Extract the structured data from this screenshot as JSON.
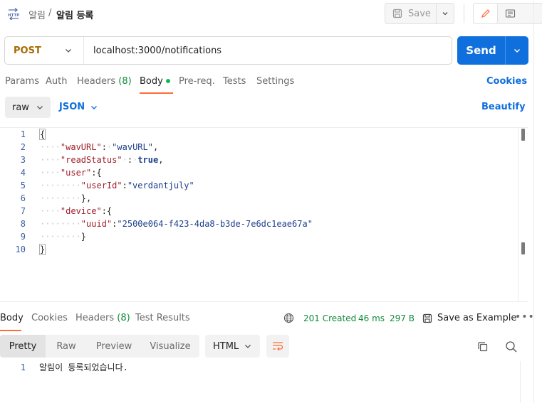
{
  "breadcrumb": {
    "parent": "알림",
    "separator": "/",
    "current": "알림 등록"
  },
  "toolbar": {
    "save_label": "Save"
  },
  "request": {
    "method": "POST",
    "url": "localhost:3000/notifications",
    "send_label": "Send"
  },
  "request_tabs": [
    {
      "label": "Params"
    },
    {
      "label": "Auth"
    },
    {
      "label": "Headers",
      "count": "(8)"
    },
    {
      "label": "Body"
    },
    {
      "label": "Pre-req."
    },
    {
      "label": "Tests"
    },
    {
      "label": "Settings"
    }
  ],
  "cookies_label": "Cookies",
  "body_options": {
    "mode": "raw",
    "language": "JSON",
    "beautify_label": "Beautify"
  },
  "editor": {
    "line_numbers": [
      "1",
      "2",
      "3",
      "4",
      "5",
      "6",
      "7",
      "8",
      "9",
      "10"
    ],
    "lines": [
      {
        "dots": "",
        "tokens": [
          {
            "t": "punc",
            "v": "{"
          }
        ]
      },
      {
        "dots": "····",
        "tokens": [
          {
            "t": "key",
            "v": "\"wavURL\""
          },
          {
            "t": "punc",
            "v": ":"
          },
          {
            "t": "dot",
            "v": "·"
          },
          {
            "t": "str",
            "v": "\"wavURL\""
          },
          {
            "t": "punc",
            "v": ","
          }
        ]
      },
      {
        "dots": "····",
        "tokens": [
          {
            "t": "key",
            "v": "\"readStatus\""
          },
          {
            "t": "dot",
            "v": "·"
          },
          {
            "t": "punc",
            "v": ":"
          },
          {
            "t": "dot",
            "v": "·"
          },
          {
            "t": "kw",
            "v": "true"
          },
          {
            "t": "punc",
            "v": ","
          }
        ]
      },
      {
        "dots": "····",
        "tokens": [
          {
            "t": "key",
            "v": "\"user\""
          },
          {
            "t": "punc",
            "v": ":{"
          }
        ]
      },
      {
        "dots": "········",
        "tokens": [
          {
            "t": "key",
            "v": "\"userId\""
          },
          {
            "t": "punc",
            "v": ":"
          },
          {
            "t": "str",
            "v": "\"verdantjuly\""
          }
        ]
      },
      {
        "dots": "········",
        "tokens": [
          {
            "t": "punc",
            "v": "},"
          }
        ]
      },
      {
        "dots": "····",
        "tokens": [
          {
            "t": "key",
            "v": "\"device\""
          },
          {
            "t": "punc",
            "v": ":{"
          }
        ]
      },
      {
        "dots": "········",
        "tokens": [
          {
            "t": "key",
            "v": "\"uuid\""
          },
          {
            "t": "punc",
            "v": ":"
          },
          {
            "t": "str",
            "v": "\"2500e064-f423-4da8-b3de-7e6dc1eae67a\""
          }
        ]
      },
      {
        "dots": "········",
        "tokens": [
          {
            "t": "punc",
            "v": "}"
          }
        ]
      },
      {
        "dots": "",
        "tokens": [
          {
            "t": "punc",
            "v": "}"
          }
        ]
      }
    ]
  },
  "response_tabs": [
    {
      "label": "Body"
    },
    {
      "label": "Cookies"
    },
    {
      "label": "Headers",
      "count": "(8)"
    },
    {
      "label": "Test Results"
    }
  ],
  "response_status": {
    "code": "201 Created",
    "time": "46 ms",
    "size": "297 B"
  },
  "save_example_label": "Save as Example",
  "more_label": "•••",
  "view_tabs": [
    "Pretty",
    "Raw",
    "Preview",
    "Visualize"
  ],
  "format": "HTML",
  "response_body": {
    "line_number": "1",
    "text": "알림이 등록되었습니다."
  },
  "colors": {
    "accent": "#ff6c37",
    "primary": "#0f6fdd",
    "success": "#0f8a3a",
    "method": "#a86a00"
  }
}
